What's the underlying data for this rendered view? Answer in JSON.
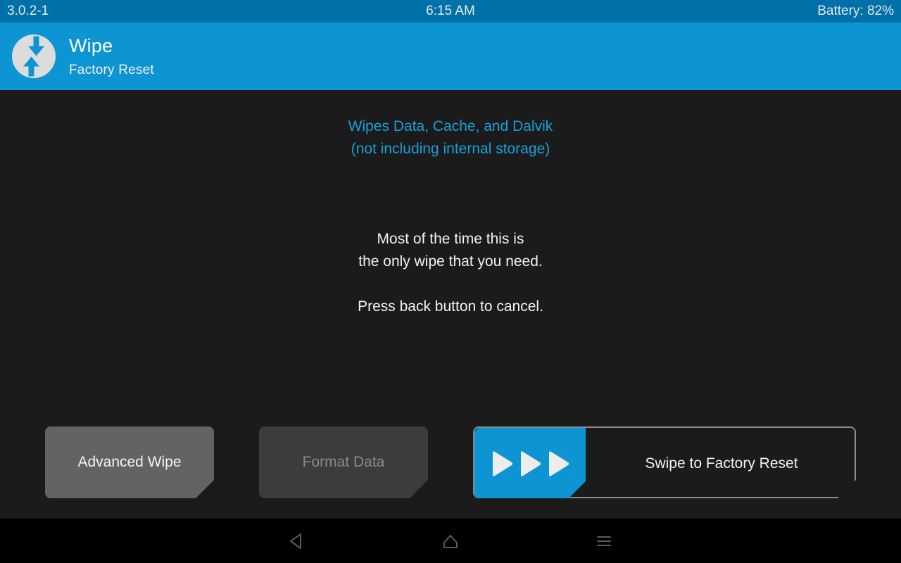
{
  "status_bar": {
    "version": "3.0.2-1",
    "clock": "6:15 AM",
    "battery": "Battery: 82%"
  },
  "header": {
    "logo_name": "twrp-logo-icon",
    "title": "Wipe",
    "subtitle": "Factory Reset"
  },
  "main": {
    "info_blue_line1": "Wipes Data, Cache, and Dalvik",
    "info_blue_line2": "(not including internal storage)",
    "info_white_line1": "Most of the time this is",
    "info_white_line2": "the only wipe that you need.",
    "info_white_line3": "Press back button to cancel."
  },
  "buttons": {
    "advanced_wipe": "Advanced Wipe",
    "format_data": "Format Data"
  },
  "swipe": {
    "label": "Swipe to Factory Reset",
    "arrow_icon": "play-arrow-icon"
  },
  "nav_bar": {
    "back": "back-icon",
    "home": "home-icon",
    "menu": "menu-icon"
  },
  "colors": {
    "status_bar_blue": "#0071a8",
    "header_blue": "#0d94d2",
    "accent_blue": "#199fda",
    "background_dark": "#1b1b1b",
    "nav_black": "#000000",
    "button_active": "#636363",
    "button_disabled": "#3c3c3c",
    "text_white": "#f2f2f2",
    "text_disabled": "#8a8a8a",
    "swipe_border": "#8c8c8c"
  }
}
